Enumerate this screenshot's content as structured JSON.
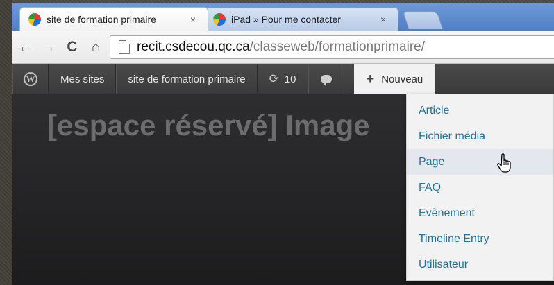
{
  "browser": {
    "tabs": [
      {
        "title": "site de formation primaire",
        "close": "×",
        "active": true
      },
      {
        "title": "iPad » Pour me contacter",
        "close": "×",
        "active": false
      }
    ],
    "toolbar": {
      "back": "←",
      "forward": "→",
      "reload": "C",
      "home": "⌂"
    },
    "url": {
      "host": "recit.csdecou.qc.ca",
      "path": "/classeweb/formationprimaire/"
    }
  },
  "adminbar": {
    "logo": "W",
    "my_sites": "Mes sites",
    "site_name": "site de formation primaire",
    "updates_icon": "⟳",
    "updates_count": "10",
    "new_plus": "+",
    "new_label": "Nouveau"
  },
  "page": {
    "placeholder_title": "[espace réservé] Image"
  },
  "new_menu": {
    "items": [
      {
        "label": "Article"
      },
      {
        "label": "Fichier média"
      },
      {
        "label": "Page"
      },
      {
        "label": "FAQ"
      },
      {
        "label": "Evènement"
      },
      {
        "label": "Timeline Entry"
      },
      {
        "label": "Utilisateur"
      }
    ],
    "hovered_item": "Page"
  },
  "colors": {
    "menu_link": "#21759b",
    "adminbar_bg": "#464646",
    "tabstrip": "#5a88cc"
  },
  "icons": [
    "chrome-favicon",
    "close-icon",
    "back-arrow-icon",
    "forward-arrow-icon",
    "reload-icon",
    "home-icon",
    "page-icon",
    "wordpress-logo-icon",
    "updates-icon",
    "comment-bubble-icon",
    "plus-icon",
    "hand-cursor-icon"
  ]
}
